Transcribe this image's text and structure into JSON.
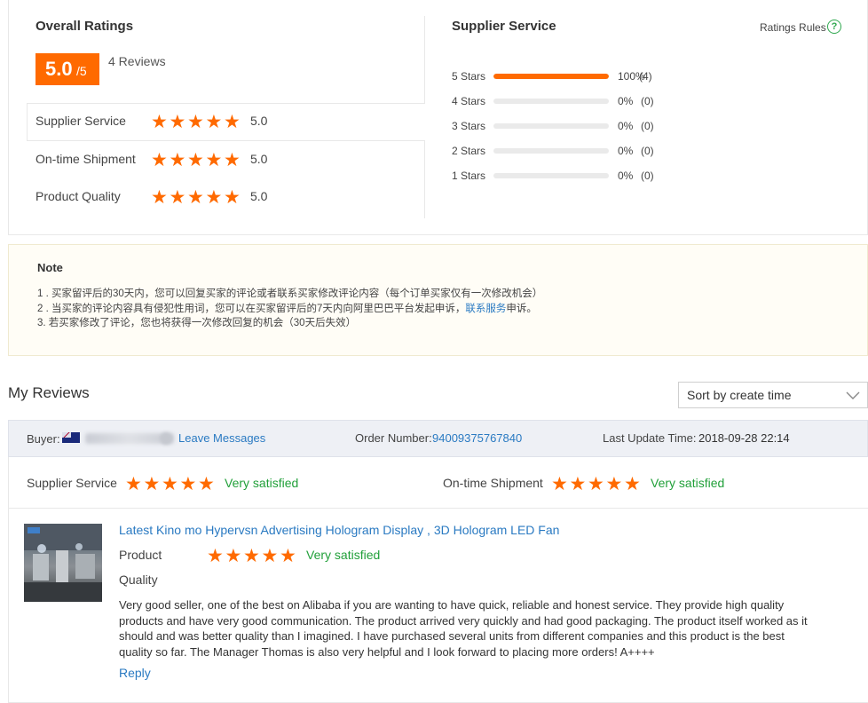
{
  "overall": {
    "title": "Overall Ratings",
    "score": "5.0",
    "score_max": "/5",
    "reviews": "4 Reviews",
    "rows": [
      {
        "label": "Supplier Service",
        "value": "5.0",
        "stars": 5
      },
      {
        "label": "On-time Shipment",
        "value": "5.0",
        "stars": 5
      },
      {
        "label": "Product Quality",
        "value": "5.0",
        "stars": 5
      }
    ]
  },
  "supplier_service": {
    "title": "Supplier Service",
    "rules_label": "Ratings Rules",
    "help_icon": "?",
    "breakdown": [
      {
        "label": "5 Stars",
        "percent": "100%",
        "count": "(4)",
        "fill": 1.0
      },
      {
        "label": "4 Stars",
        "percent": "0%",
        "count": "(0)",
        "fill": 0
      },
      {
        "label": "3 Stars",
        "percent": "0%",
        "count": "(0)",
        "fill": 0
      },
      {
        "label": "2 Stars",
        "percent": "0%",
        "count": "(0)",
        "fill": 0
      },
      {
        "label": "1 Stars",
        "percent": "0%",
        "count": "(0)",
        "fill": 0
      }
    ]
  },
  "note": {
    "title": "Note",
    "line1": "1 . 买家留评后的30天内，您可以回复买家的评论或者联系买家修改评论内容（每个订单买家仅有一次修改机会）",
    "line2_a": "2 . 当买家的评论内容具有侵犯性用词，您可以在买家留评后的7天内向阿里巴巴平台发起申诉，",
    "line2_link": "联系服务",
    "line2_b": "申诉。",
    "line3": "3. 若买家修改了评论，您也将获得一次修改回复的机会（30天后失效）"
  },
  "my_reviews": {
    "title": "My Reviews",
    "sort_label": "Sort by create time"
  },
  "review": {
    "buyer_label": "Buyer:",
    "leave_messages": "Leave Messages",
    "order_label": "Order Number:",
    "order_number": "94009375767840",
    "update_label": "Last Update Time:",
    "update_time": "2018-09-28 22:14",
    "supplier_service_label": "Supplier Service",
    "supplier_service_text": "Very satisfied",
    "shipment_label": "On-time Shipment",
    "shipment_text": "Very satisfied",
    "product_title": "Latest Kino mo Hypervsn Advertising Hologram Display , 3D Hologram LED Fan",
    "quality_label_1": "Product",
    "quality_label_2": "Quality",
    "quality_text": "Very satisfied",
    "body": "Very good seller, one of the best on Alibaba if you are wanting to have quick, reliable and honest service. They provide high quality products and have very good communication. The product arrived very quickly and had good packaging. The product itself worked as it should and was better quality than I imagined. I have purchased several units from different companies and this product is the best quality so far. The Manager Thomas is also very helpful and I look forward to placing more orders! A++++",
    "reply": "Reply"
  },
  "colors": {
    "accent": "#ff6a00",
    "link": "#2a7ac2",
    "satisfied": "#22a03a"
  },
  "icons": {
    "star": "star-icon",
    "help": "question-icon",
    "chevron": "chevron-down-icon",
    "flag": "flag-icon"
  }
}
